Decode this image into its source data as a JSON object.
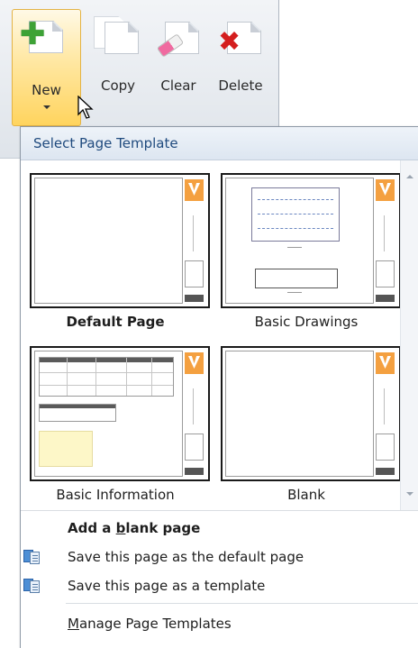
{
  "ribbon": {
    "buttons": [
      {
        "label": "New",
        "icon": "new-page-plus-icon",
        "accent": "#3da236",
        "state": "hovered"
      },
      {
        "label": "Copy",
        "icon": "copy-page-icon"
      },
      {
        "label": "Clear",
        "icon": "clear-page-eraser-icon"
      },
      {
        "label": "Delete",
        "icon": "delete-page-x-icon",
        "accent": "#d41e1e"
      }
    ]
  },
  "panel": {
    "header": "Select Page Template",
    "templates": [
      {
        "label": "Default Page",
        "selected": true
      },
      {
        "label": "Basic Drawings",
        "selected": false
      },
      {
        "label": "Basic Information",
        "selected": false
      },
      {
        "label": "Blank",
        "selected": false
      }
    ],
    "menu": {
      "add_blank": {
        "before": "Add a ",
        "mnemonic": "b",
        "after": "lank page"
      },
      "save_default": "Save this page as the default page",
      "save_template": "Save this page as a template",
      "manage": {
        "mnemonic": "M",
        "after": "anage Page Templates"
      }
    }
  },
  "colors": {
    "header_text": "#1f4a7e",
    "hover_gold": "#ffd45e",
    "logo_orange": "#f4a040"
  }
}
